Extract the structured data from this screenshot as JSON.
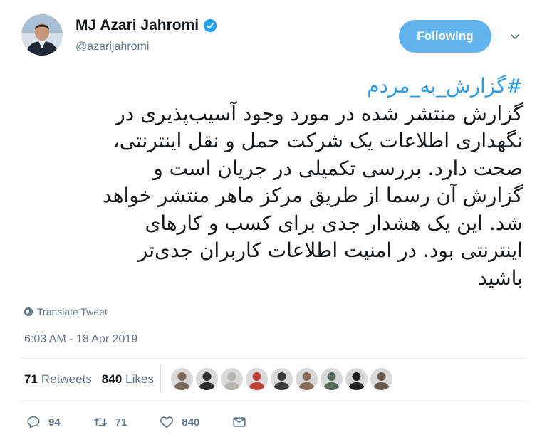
{
  "author": {
    "name": "MJ Azari Jahromi",
    "handle": "@azarijahromi",
    "verified": true
  },
  "follow_button": {
    "label": "Following",
    "color": "#62b4ee"
  },
  "tweet": {
    "hashtag": "#گزارش_به_مردم",
    "lines": [
      "گزارش منتشر شده در مورد وجود آسیب‌پذیری در",
      "نگهداری اطلاعات یک شرکت حمل و نقل اینترنتی،",
      "صحت دارد. بررسی تکمیلی در جریان است و",
      "گزارش آن رسما از طریق مرکز ماهر منتشر خواهد",
      "شد. این یک هشدار جدی برای کسب و کارهای",
      "اینترنتی بود. در امنیت اطلاعات کاربران جدی‌تر",
      "باشید"
    ],
    "hashtag_color": "#2d9ce8"
  },
  "translate_label": "Translate Tweet",
  "timestamp": "6:03 AM - 18 Apr 2019",
  "stats": {
    "retweets_count": "71",
    "retweets_label": "Retweets",
    "likes_count": "840",
    "likes_label": "Likes"
  },
  "likers": [
    {
      "icon": "liker-avatar-1",
      "color": "#7a6a5e"
    },
    {
      "icon": "liker-avatar-2",
      "color": "#2b2b2b"
    },
    {
      "icon": "liker-avatar-3",
      "color": "#b9b6b0"
    },
    {
      "icon": "liker-avatar-4",
      "color": "#c0433a"
    },
    {
      "icon": "liker-avatar-5",
      "color": "#3a3a3a"
    },
    {
      "icon": "liker-avatar-6",
      "color": "#8a6a5a"
    },
    {
      "icon": "liker-avatar-7",
      "color": "#5b6b5b"
    },
    {
      "icon": "liker-avatar-8",
      "color": "#1f1f1f"
    },
    {
      "icon": "liker-avatar-9",
      "color": "#6b5a4e"
    }
  ],
  "actions": {
    "reply_count": "94",
    "retweet_count": "71",
    "like_count": "840"
  },
  "icons": {
    "verified": "verified-badge-icon",
    "chevron": "chevron-down-icon",
    "globe": "globe-icon",
    "reply": "reply-icon",
    "retweet": "retweet-icon",
    "like": "heart-icon",
    "message": "envelope-icon"
  }
}
